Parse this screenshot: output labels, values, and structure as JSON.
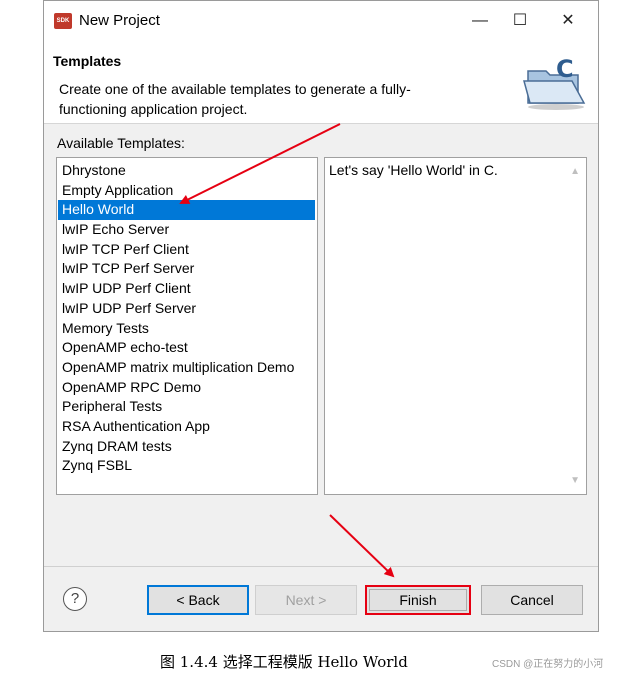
{
  "window": {
    "icon_label": "SDK",
    "title": "New Project",
    "minimize": "—",
    "maximize": "☐",
    "close": "✕"
  },
  "header": {
    "title": "Templates",
    "description": "Create one of the available templates to generate a fully-functioning application project."
  },
  "templates": {
    "label": "Available Templates:",
    "items": [
      "Dhrystone",
      "Empty Application",
      "Hello World",
      "lwIP Echo Server",
      "lwIP TCP Perf Client",
      "lwIP TCP Perf Server",
      "lwIP UDP Perf Client",
      "lwIP UDP Perf Server",
      "Memory Tests",
      "OpenAMP echo-test",
      "OpenAMP matrix multiplication Demo",
      "OpenAMP RPC Demo",
      "Peripheral Tests",
      "RSA Authentication App",
      "Zynq DRAM tests",
      "Zynq FSBL"
    ],
    "selected": "Hello World",
    "description": "Let's say 'Hello World' in C."
  },
  "buttons": {
    "help": "?",
    "back": "< Back",
    "next": "Next >",
    "finish": "Finish",
    "cancel": "Cancel"
  },
  "caption": "图 1.4.4 选择工程模版 Hello World",
  "watermark": "CSDN @正在努力的小河",
  "colors": {
    "selection": "#0078d7",
    "annotation": "#e60012"
  }
}
